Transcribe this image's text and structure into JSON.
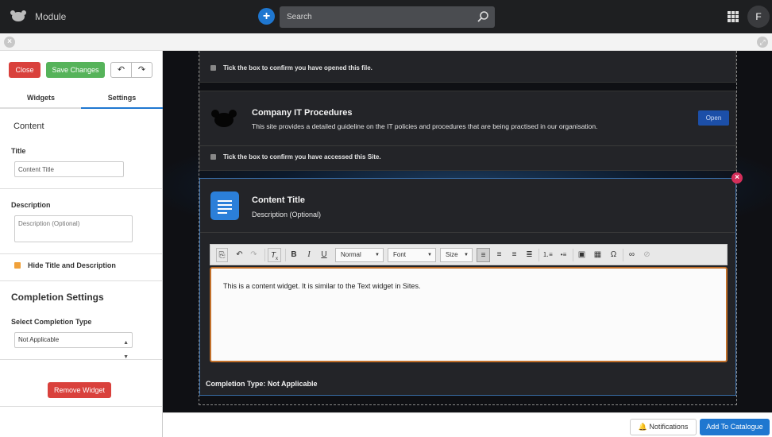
{
  "header": {
    "app_title": "Module",
    "search_placeholder": "Search",
    "avatar_initial": "F"
  },
  "sidebar": {
    "close_label": "Close",
    "save_label": "Save Changes",
    "tabs": [
      {
        "label": "Widgets",
        "active": false
      },
      {
        "label": "Settings",
        "active": true
      }
    ],
    "content_heading": "Content",
    "title_label": "Title",
    "title_value": "Content Title",
    "description_label": "Description",
    "description_placeholder": "Description (Optional)",
    "hide_title_label": "Hide Title and Description",
    "hide_title_checked": true,
    "completion_heading": "Completion Settings",
    "completion_type_label": "Select Completion Type",
    "completion_type_value": "Not Applicable",
    "remove_label": "Remove Widget"
  },
  "canvas": {
    "file_confirm_text": "Tick the box to confirm you have opened this file.",
    "site_title": "Company IT Procedures",
    "site_description": "This site provides a detailed guideline on the IT policies and procedures that are being practised in our organisation.",
    "open_label": "Open",
    "site_confirm_text": "Tick the box to confirm you have accessed this Site.",
    "widget_title": "Content Title",
    "widget_description": "Description (Optional)",
    "editor": {
      "format_value": "Normal",
      "font_value": "Font",
      "size_value": "Size",
      "body_text": "This is a content widget. It is similar to the Text widget in Sites."
    },
    "completion_text": "Completion Type: Not Applicable"
  },
  "footer": {
    "notifications_label": "Notifications",
    "catalogue_label": "Add To Catalogue"
  },
  "colors": {
    "accent": "#1f77d0",
    "danger": "#d9413c",
    "success": "#56b35a",
    "editor_border": "#c2702a"
  }
}
